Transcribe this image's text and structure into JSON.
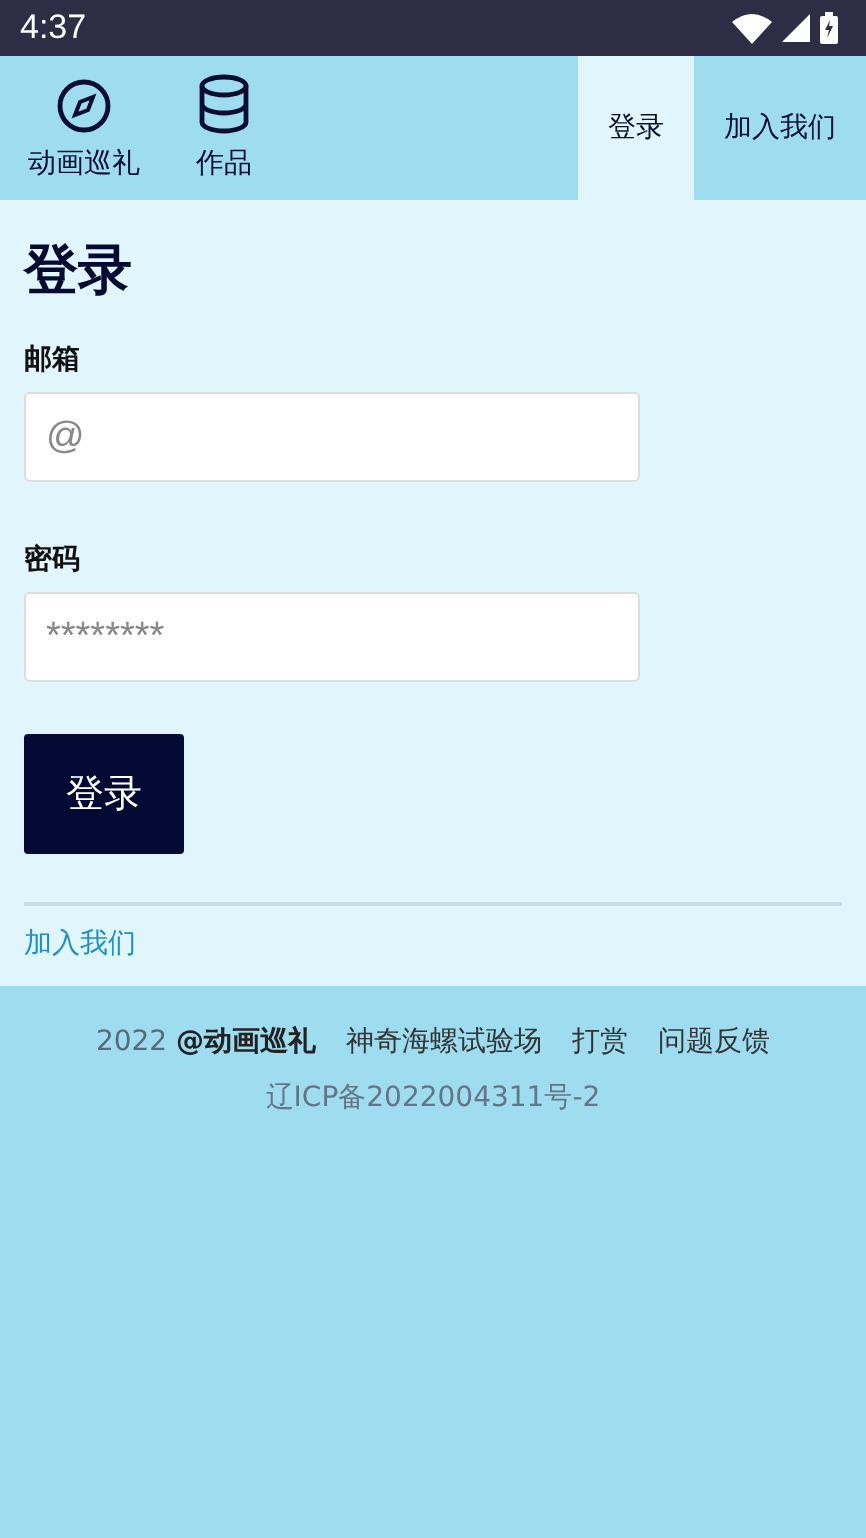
{
  "status_bar": {
    "time": "4:37"
  },
  "nav": {
    "items": [
      {
        "label": "动画巡礼",
        "kind": "compass"
      },
      {
        "label": "作品",
        "kind": "database"
      }
    ],
    "tabs": [
      {
        "label": "登录",
        "selected": true
      },
      {
        "label": "加入我们",
        "selected": false
      }
    ]
  },
  "form": {
    "title": "登录",
    "fields": [
      {
        "label": "邮箱",
        "placeholder": "@"
      },
      {
        "label": "密码",
        "placeholder": "********"
      }
    ],
    "submit": "登录",
    "join_link": "加入我们"
  },
  "footer": {
    "copyright": "2022 **@动画巡礼**",
    "links": [
      "神奇海螺试验场",
      "打赏",
      "问题反馈"
    ],
    "icp": "辽ICP备2022004311号-2"
  }
}
